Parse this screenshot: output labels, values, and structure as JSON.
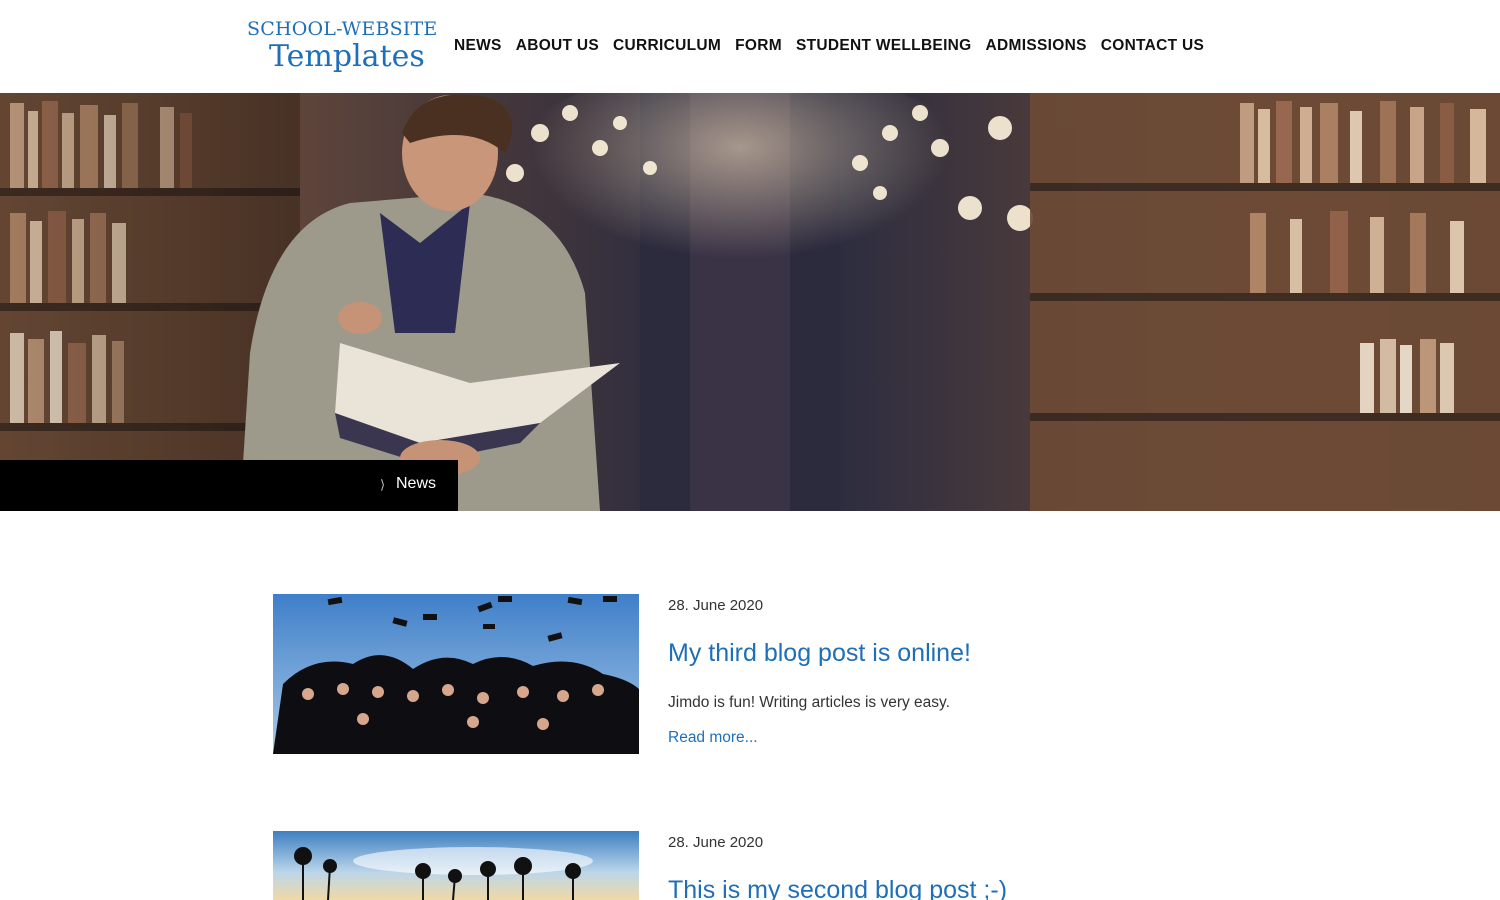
{
  "header": {
    "logo_line1": "SCHOOL-WEBSITE",
    "logo_line2": "Templates",
    "nav": [
      {
        "label": "NEWS"
      },
      {
        "label": "ABOUT US"
      },
      {
        "label": "CURRICULUM"
      },
      {
        "label": "FORM"
      },
      {
        "label": "STUDENT WELLBEING"
      },
      {
        "label": "ADMISSIONS"
      },
      {
        "label": "CONTACT US"
      }
    ]
  },
  "breadcrumb": {
    "separator": "⟩",
    "current": "News"
  },
  "posts": [
    {
      "date": "28. June 2020",
      "title": "My third blog post is online!",
      "excerpt": "Jimdo is fun! Writing articles is very easy.",
      "read_more": "Read more..."
    },
    {
      "date": "28. June 2020",
      "title": "This is my second blog post ;-)"
    }
  ],
  "colors": {
    "brand_blue": "#1f6fb8",
    "breadcrumb_bg": "#000000"
  }
}
